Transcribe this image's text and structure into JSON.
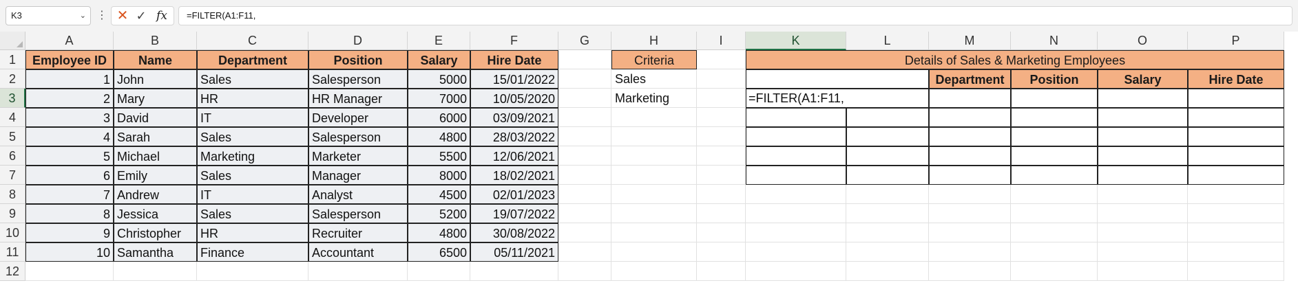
{
  "formula_bar": {
    "name_box": "K3",
    "cancel_icon": "close-icon",
    "enter_icon": "check-icon",
    "fx_label": "fx",
    "formula": "=FILTER(A1:F11,"
  },
  "columns": [
    "A",
    "B",
    "C",
    "D",
    "E",
    "F",
    "G",
    "H",
    "I",
    "K",
    "L",
    "M",
    "N",
    "O",
    "P"
  ],
  "rows": [
    "1",
    "2",
    "3",
    "4",
    "5",
    "6",
    "7",
    "8",
    "9",
    "10",
    "11",
    "12"
  ],
  "table": {
    "headers": [
      "Employee ID",
      "Name",
      "Department",
      "Position",
      "Salary",
      "Hire Date"
    ],
    "rows": [
      [
        "1",
        "John",
        "Sales",
        "Salesperson",
        "5000",
        "15/01/2022"
      ],
      [
        "2",
        "Mary",
        "HR",
        "HR Manager",
        "7000",
        "10/05/2020"
      ],
      [
        "3",
        "David",
        "IT",
        "Developer",
        "6000",
        "03/09/2021"
      ],
      [
        "4",
        "Sarah",
        "Sales",
        "Salesperson",
        "4800",
        "28/03/2022"
      ],
      [
        "5",
        "Michael",
        "Marketing",
        "Marketer",
        "5500",
        "12/06/2021"
      ],
      [
        "6",
        "Emily",
        "Sales",
        "Manager",
        "8000",
        "18/02/2021"
      ],
      [
        "7",
        "Andrew",
        "IT",
        "Analyst",
        "4500",
        "02/01/2023"
      ],
      [
        "8",
        "Jessica",
        "Sales",
        "Salesperson",
        "5200",
        "19/07/2022"
      ],
      [
        "9",
        "Christopher",
        "HR",
        "Recruiter",
        "4800",
        "30/08/2022"
      ],
      [
        "10",
        "Samantha",
        "Finance",
        "Accountant",
        "6500",
        "05/11/2021"
      ]
    ]
  },
  "criteria": {
    "header": "Criteria",
    "values": [
      "Sales",
      "Marketing"
    ]
  },
  "output": {
    "title": "Details of Sales & Marketing Employees",
    "headers": [
      "Department",
      "Position",
      "Salary",
      "Hire Date"
    ],
    "active_cell_text": "=FILTER(A1:F11,"
  },
  "colors": {
    "header_fill": "#f4b084",
    "data_fill": "#eef0f3",
    "selection": "#217346"
  }
}
